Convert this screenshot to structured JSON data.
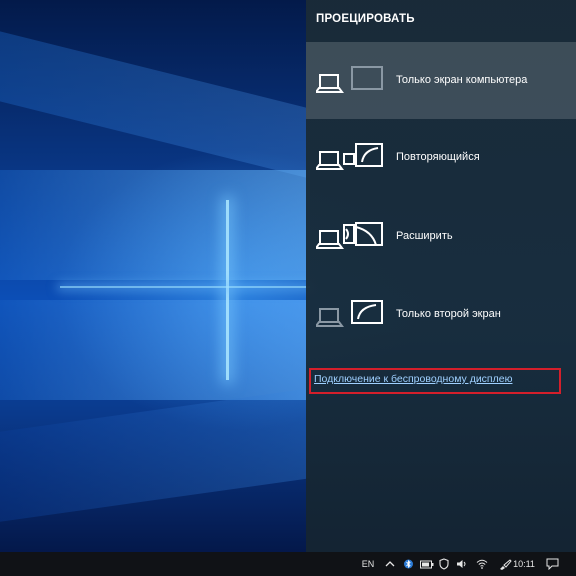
{
  "panel": {
    "title": "ПРОЕЦИРОВАТЬ",
    "options": [
      {
        "label": "Только экран компьютера",
        "icon": "pc-screen-only-icon",
        "selected": true
      },
      {
        "label": "Повторяющийся",
        "icon": "duplicate-icon",
        "selected": false
      },
      {
        "label": "Расширить",
        "icon": "extend-icon",
        "selected": false
      },
      {
        "label": "Только второй экран",
        "icon": "second-screen-only-icon",
        "selected": false
      }
    ],
    "wireless_link": "Подключение к беспроводному дисплею"
  },
  "taskbar": {
    "language": "EN",
    "time": "10:11",
    "tray_icons": [
      "chevron-up-icon",
      "bluetooth-icon",
      "battery-icon",
      "defender-icon",
      "volume-icon",
      "wifi-icon",
      "notification-icon"
    ]
  },
  "colors": {
    "panel_bg": "#1a2b38",
    "link": "#9fd0ff",
    "highlight": "#d41f2b",
    "taskbar": "#101216"
  }
}
